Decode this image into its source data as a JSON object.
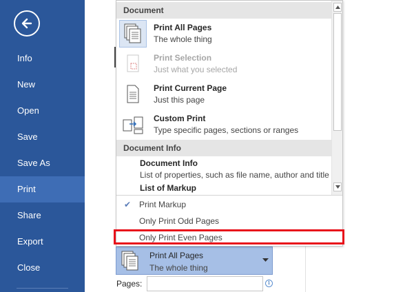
{
  "nav": {
    "items": [
      {
        "label": "Info"
      },
      {
        "label": "New"
      },
      {
        "label": "Open"
      },
      {
        "label": "Save"
      },
      {
        "label": "Save As"
      },
      {
        "label": "Print"
      },
      {
        "label": "Share"
      },
      {
        "label": "Export"
      },
      {
        "label": "Close"
      }
    ],
    "active": "Print"
  },
  "dropdown": {
    "document_header": "Document",
    "options": [
      {
        "title": "Print All Pages",
        "desc": "The whole thing",
        "icon": "all-pages-icon",
        "selected": true,
        "disabled": false
      },
      {
        "title": "Print Selection",
        "desc": "Just what you selected",
        "icon": "selection-icon",
        "selected": false,
        "disabled": true
      },
      {
        "title": "Print Current Page",
        "desc": "Just this page",
        "icon": "current-page-icon",
        "selected": false,
        "disabled": false
      },
      {
        "title": "Custom Print",
        "desc": "Type specific pages, sections or ranges",
        "icon": "custom-print-icon",
        "selected": false,
        "disabled": false
      }
    ],
    "document_info_header": "Document Info",
    "info_items": [
      {
        "title": "Document Info",
        "desc": "List of properties, such as file name, author and title"
      },
      {
        "title": "List of Markup",
        "desc": ""
      }
    ],
    "toggles": [
      {
        "label": "Print Markup",
        "checked": true
      },
      {
        "label": "Only Print Odd Pages",
        "checked": false
      },
      {
        "label": "Only Print Even Pages",
        "checked": false
      }
    ]
  },
  "print_what": {
    "title": "Print All Pages",
    "desc": "The whole thing"
  },
  "pages": {
    "label": "Pages:",
    "value": ""
  },
  "colors": {
    "nav_bg": "#2b579a",
    "nav_active": "#3e6db5",
    "highlight": "#e8101a",
    "selected_button": "#a6bfe6"
  }
}
